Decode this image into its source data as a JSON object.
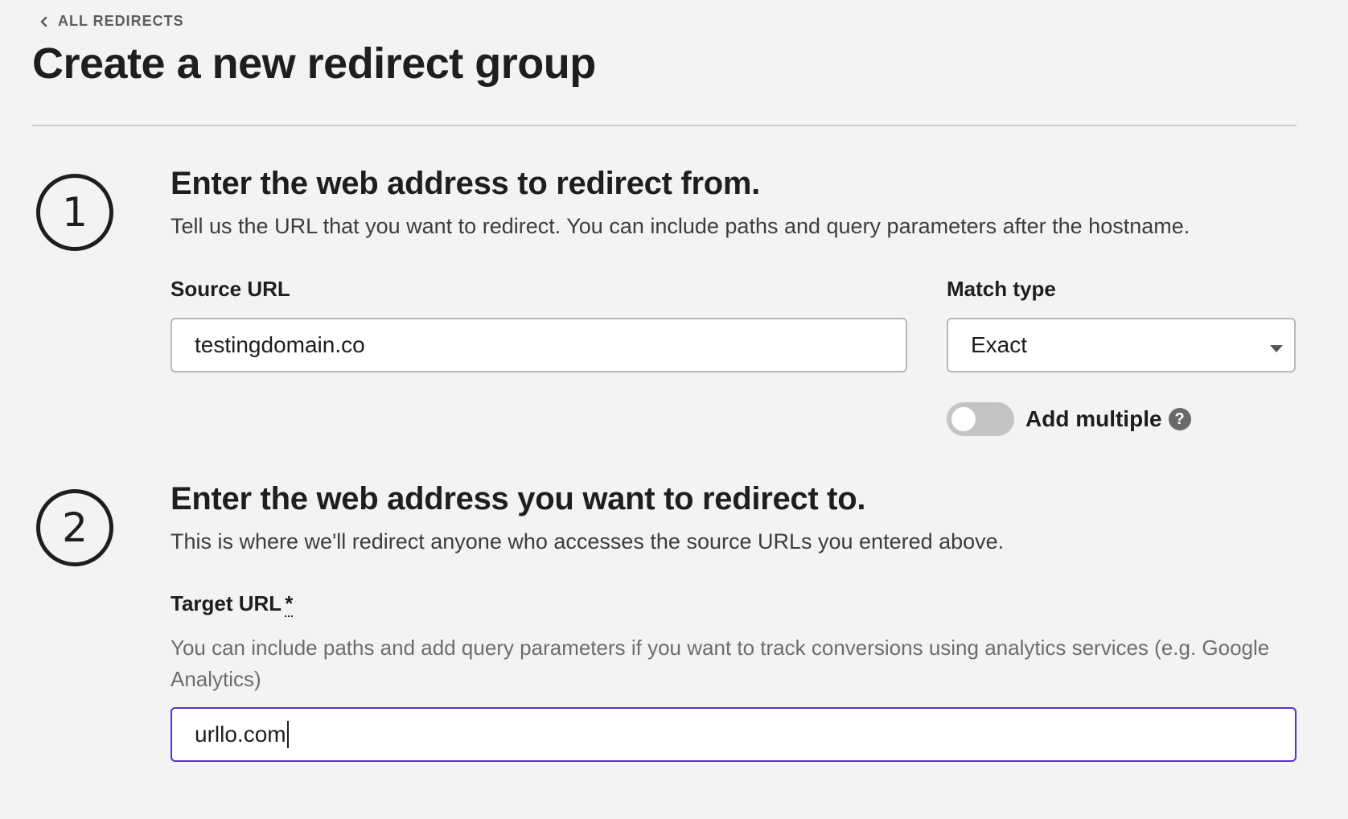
{
  "nav": {
    "back_label": "ALL REDIRECTS"
  },
  "header": {
    "title": "Create a new redirect group"
  },
  "step1": {
    "number": "1",
    "title": "Enter the web address to redirect from.",
    "description": "Tell us the URL that you want to redirect. You can include paths and query parameters after the hostname.",
    "source_label": "Source URL",
    "source_value": "testingdomain.co",
    "match_label": "Match type",
    "match_value": "Exact",
    "add_multiple_label": "Add multiple",
    "add_multiple_on": false,
    "help_glyph": "?"
  },
  "step2": {
    "number": "2",
    "title": "Enter the web address you want to redirect to.",
    "description": "This is where we'll redirect anyone who accesses the source URLs you entered above.",
    "target_label": "Target URL",
    "required_mark": "*",
    "help_text": "You can include paths and add query parameters if you want to track conversions using analytics services (e.g. Google Analytics)",
    "target_value": "urllo.com"
  },
  "colors": {
    "background": "#f3f3f3",
    "focus_border": "#5b2fc9",
    "toggle_off": "#c4c4c4"
  },
  "icons": {
    "back": "chevron-left-icon",
    "help": "question-circle-icon",
    "dropdown": "caret-down-icon"
  }
}
